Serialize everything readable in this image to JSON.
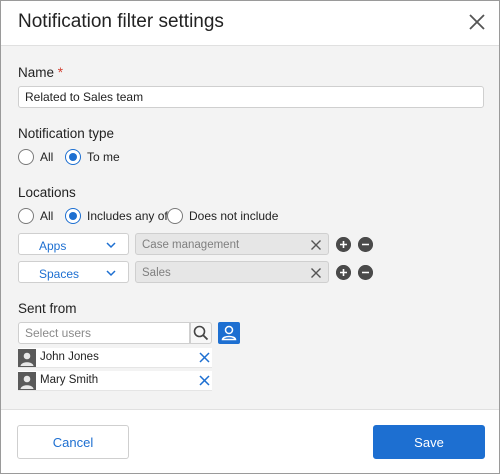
{
  "dialog": {
    "title": "Notification filter settings"
  },
  "name_field": {
    "label": "Name",
    "required_mark": "*",
    "value": "Related to Sales team"
  },
  "notification_type": {
    "label": "Notification type",
    "options": [
      {
        "label": "All",
        "selected": false
      },
      {
        "label": "To me",
        "selected": true
      }
    ]
  },
  "locations": {
    "label": "Locations",
    "options": [
      {
        "label": "All",
        "selected": false
      },
      {
        "label": "Includes any of",
        "selected": true
      },
      {
        "label": "Does not include",
        "selected": false
      }
    ],
    "rows": [
      {
        "type": "Apps",
        "value": "Case management"
      },
      {
        "type": "Spaces",
        "value": "Sales"
      }
    ]
  },
  "sent_from": {
    "label": "Sent from",
    "search_placeholder": "Select users",
    "users": [
      {
        "name": "John Jones"
      },
      {
        "name": "Mary Smith"
      }
    ]
  },
  "footer": {
    "cancel_label": "Cancel",
    "save_label": "Save"
  },
  "colors": {
    "accent": "#1d6fd1",
    "required": "#d23f31",
    "panel_bg": "#f3f3f3"
  },
  "icons": {
    "close": "close-icon",
    "chevron": "chevron-down-icon",
    "clear": "clear-icon",
    "add": "plus-circle-icon",
    "remove": "minus-circle-icon",
    "search": "search-icon",
    "user_picker": "user-icon",
    "avatar": "avatar-icon",
    "remove_user": "close-icon"
  }
}
